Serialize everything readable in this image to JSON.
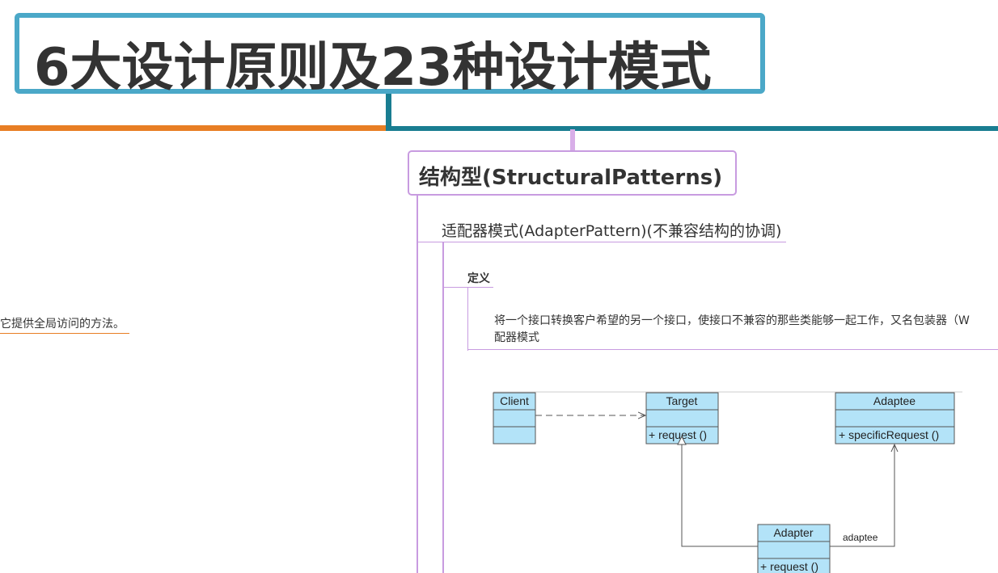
{
  "root": {
    "title": "6大设计原则及23种设计模式"
  },
  "left_branch": {
    "text": "它提供全局访问的方法。"
  },
  "structural": {
    "title": "结构型(StructuralPatterns)",
    "adapter": {
      "title": "适配器模式(AdapterPattern)(不兼容结构的协调)",
      "definition_label": "定义",
      "definition_line1": "将一个接口转换客户希望的另一个接口，使接口不兼容的那些类能够一起工作，又名包装器（W",
      "definition_line2": "配器模式"
    }
  },
  "uml": {
    "client": "Client",
    "target": "Target",
    "target_method": "+  request ()",
    "adaptee": "Adaptee",
    "adaptee_method": "+  specificRequest ()",
    "adapter": "Adapter",
    "adapter_method": "+  request ()",
    "association_label": "adaptee"
  },
  "colors": {
    "root_border": "#4ba8c8",
    "orange_branch": "#e87e24",
    "teal_branch": "#197d91",
    "purple": "#c89be0",
    "uml_fill": "#b3e3f8"
  }
}
